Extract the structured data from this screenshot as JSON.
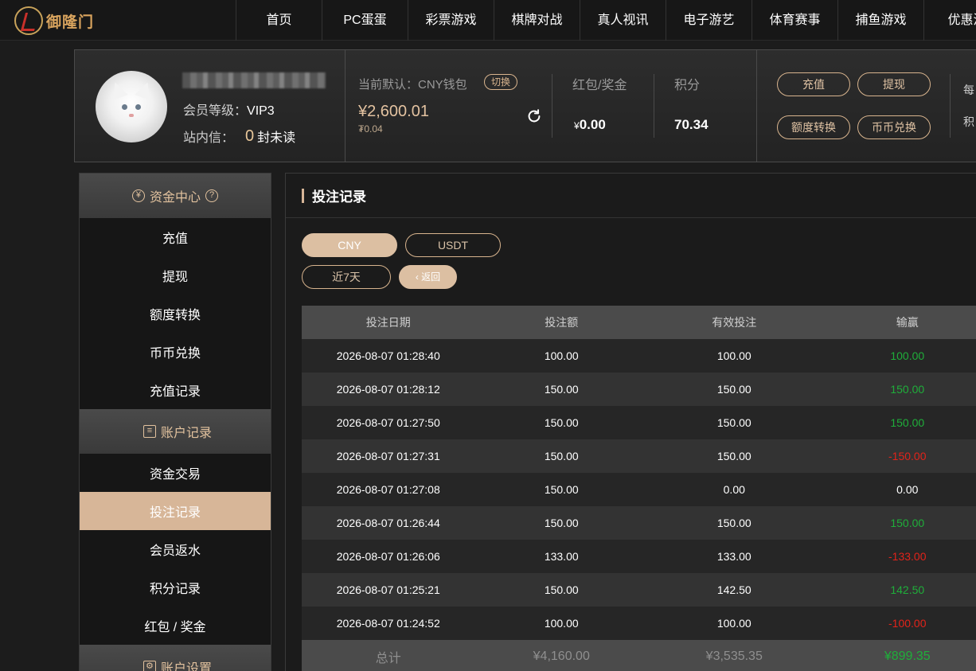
{
  "logo": {
    "text": "御隆门"
  },
  "nav": [
    "首页",
    "PC蛋蛋",
    "彩票游戏",
    "棋牌对战",
    "真人视讯",
    "电子游艺",
    "体育赛事",
    "捕鱼游戏",
    "优惠活"
  ],
  "user": {
    "vip_label": "会员等级：",
    "vip_value": "VIP3",
    "msg_label": "站内信：",
    "msg_count": "0",
    "msg_unread": "封未读"
  },
  "wallet": {
    "label": "当前默认：CNY钱包",
    "switch": "切换",
    "amount": "¥2,600.01",
    "sub_amount": "₮0.04"
  },
  "bonus": {
    "label": "红包/奖金",
    "currency": "¥",
    "value": "0.00"
  },
  "points": {
    "label": "积分",
    "value": "70.34"
  },
  "actions": {
    "recharge": "充值",
    "withdraw": "提现",
    "transfer": "额度转换",
    "exchange": "币币兑换"
  },
  "side_fragments": [
    "每",
    "积"
  ],
  "menu": {
    "fund_center": "资金中心",
    "fund_items": [
      "充值",
      "提现",
      "额度转换",
      "币币兑换",
      "充值记录"
    ],
    "account_records": "账户记录",
    "record_items": [
      "资金交易",
      "投注记录",
      "会员返水",
      "积分记录",
      "红包 / 奖金"
    ],
    "account_settings": "账户设置"
  },
  "panel": {
    "title": "投注记录",
    "currency_cny": "CNY",
    "currency_usdt": "USDT",
    "range": "近7天",
    "back": "返回"
  },
  "table": {
    "headers": [
      "投注日期",
      "投注额",
      "有效投注",
      "输赢"
    ],
    "rows": [
      [
        "2026-08-07 01:28:40",
        "100.00",
        "100.00",
        "100.00",
        "pos"
      ],
      [
        "2026-08-07 01:28:12",
        "150.00",
        "150.00",
        "150.00",
        "pos"
      ],
      [
        "2026-08-07 01:27:50",
        "150.00",
        "150.00",
        "150.00",
        "pos"
      ],
      [
        "2026-08-07 01:27:31",
        "150.00",
        "150.00",
        "-150.00",
        "neg"
      ],
      [
        "2026-08-07 01:27:08",
        "150.00",
        "0.00",
        "0.00",
        "zero"
      ],
      [
        "2026-08-07 01:26:44",
        "150.00",
        "150.00",
        "150.00",
        "pos"
      ],
      [
        "2026-08-07 01:26:06",
        "133.00",
        "133.00",
        "-133.00",
        "neg"
      ],
      [
        "2026-08-07 01:25:21",
        "150.00",
        "142.50",
        "142.50",
        "pos"
      ],
      [
        "2026-08-07 01:24:52",
        "100.00",
        "100.00",
        "-100.00",
        "neg"
      ]
    ],
    "total": [
      "总计",
      "¥4,160.00",
      "¥3,535.35",
      "¥899.35"
    ]
  },
  "colors": {
    "accent": "#d7b698",
    "win": "#1fae3a",
    "loss": "#e2231a"
  }
}
